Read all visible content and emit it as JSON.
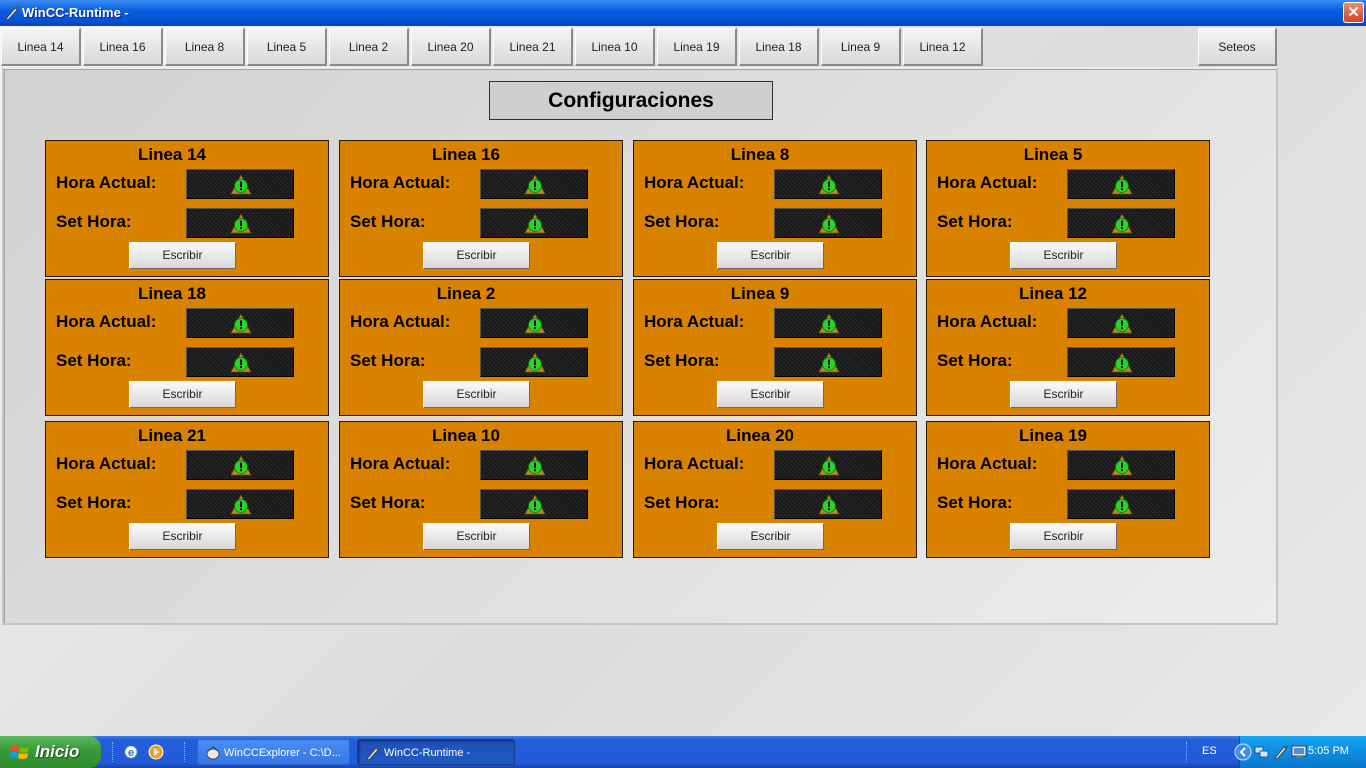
{
  "window": {
    "title": "WinCC-Runtime -",
    "close_label": "✕"
  },
  "nav": {
    "tabs": [
      {
        "label": "Linea 14"
      },
      {
        "label": "Linea 16"
      },
      {
        "label": "Linea 8"
      },
      {
        "label": "Linea 5"
      },
      {
        "label": "Linea 2"
      },
      {
        "label": "Linea 20"
      },
      {
        "label": "Linea 21"
      },
      {
        "label": "Linea 10"
      },
      {
        "label": "Linea 19"
      },
      {
        "label": "Linea 18"
      },
      {
        "label": "Linea 9"
      },
      {
        "label": "Linea 12"
      }
    ],
    "setup_label": "Seteos"
  },
  "page": {
    "title": "Configuraciones"
  },
  "labels": {
    "hora_actual": "Hora Actual:",
    "set_hora": "Set Hora:",
    "escribir": "Escribir"
  },
  "cards": [
    {
      "title": "Linea 14"
    },
    {
      "title": "Linea 16"
    },
    {
      "title": "Linea 8"
    },
    {
      "title": "Linea 5"
    },
    {
      "title": "Linea 18"
    },
    {
      "title": "Linea 2"
    },
    {
      "title": "Linea 9"
    },
    {
      "title": "Linea 12"
    },
    {
      "title": "Linea 21"
    },
    {
      "title": "Linea 10"
    },
    {
      "title": "Linea 20"
    },
    {
      "title": "Linea 19"
    }
  ],
  "taskbar": {
    "start_label": "Inicio",
    "items": [
      {
        "label": "WinCCExplorer - C:\\D..."
      },
      {
        "label": "WinCC-Runtime -"
      }
    ],
    "language": "ES",
    "clock": "5:05 PM"
  },
  "colors": {
    "card_bg": "#d98200",
    "warning_icon": "#22cc22"
  }
}
